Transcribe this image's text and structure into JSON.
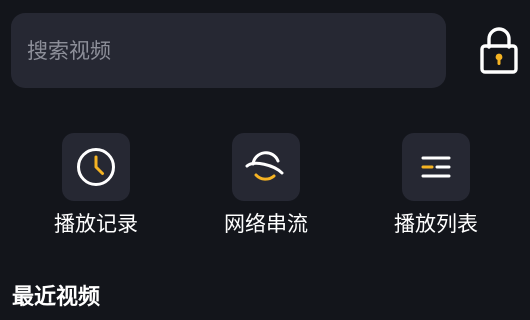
{
  "search": {
    "placeholder": "搜索视频",
    "value": ""
  },
  "lock": {
    "icon": "lock-icon",
    "accent_color": "#f5b323"
  },
  "quick_actions": [
    {
      "label": "播放记录",
      "icon": "clock-icon"
    },
    {
      "label": "网络串流",
      "icon": "planet-icon"
    },
    {
      "label": "播放列表",
      "icon": "playlist-icon"
    }
  ],
  "sections": {
    "recent_title": "最近视频"
  },
  "colors": {
    "background": "#13151b",
    "surface": "#262833",
    "accent": "#f5b323",
    "text": "#ffffff",
    "placeholder": "#8d8f99"
  }
}
